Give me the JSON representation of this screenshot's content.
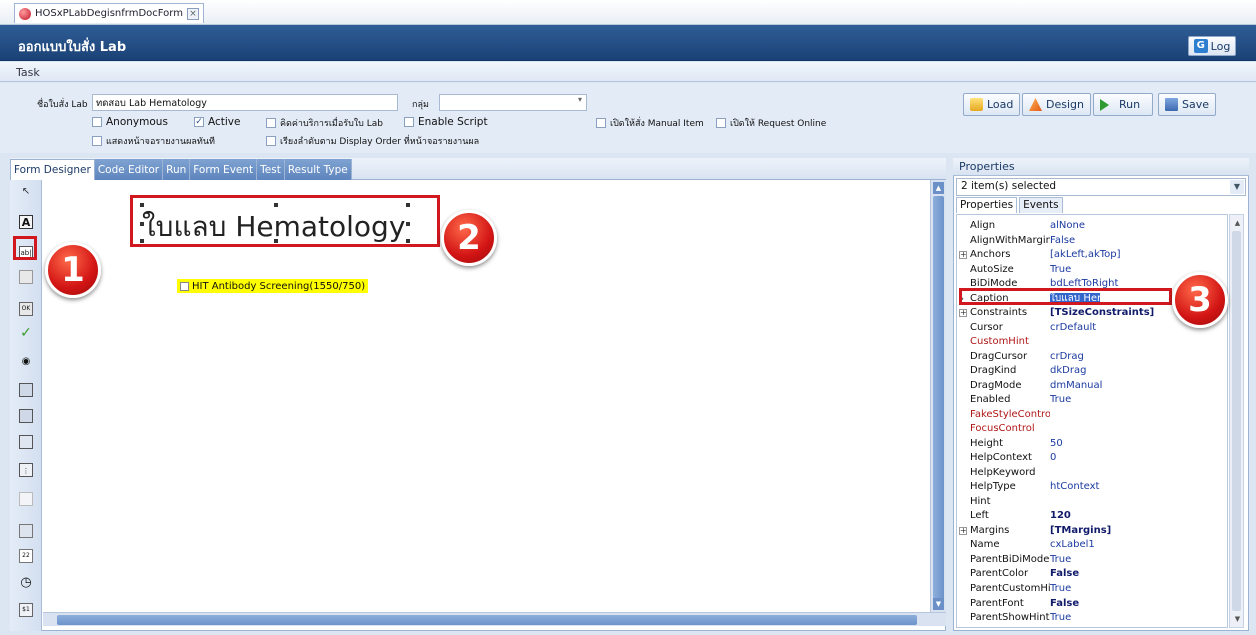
{
  "window_tab": {
    "label": "HOSxPLabDegisnfrmDocForm",
    "close": "×"
  },
  "header": {
    "title": "ออกแบบใบสั่ง Lab",
    "log_label": "Log",
    "log_icon": "G"
  },
  "task_label": "Task",
  "form": {
    "name_label": "ชื่อใบสั่ง Lab",
    "name_value": "ทดสอบ Lab Hematology",
    "group_label": "กลุ่ม",
    "group_value": "",
    "checkboxes": [
      {
        "label": "Anonymous",
        "checked": false
      },
      {
        "label": "Active",
        "checked": true
      },
      {
        "label": "คิดค่าบริการเมื่อรับใบ Lab",
        "checked": false
      },
      {
        "label": "Enable Script",
        "checked": false
      },
      {
        "label": "เปิดให้สั่ง Manual Item",
        "checked": false
      },
      {
        "label": "เปิดให้ Request Online",
        "checked": false
      },
      {
        "label": "แสดงหน้าจอรายงานผลทันที",
        "checked": false
      },
      {
        "label": "เรียงลำดับตาม Display Order ที่หน้าจอรายงานผล",
        "checked": false
      }
    ]
  },
  "toolbar": {
    "load": "Load",
    "design": "Design",
    "run": "Run",
    "save": "Save"
  },
  "designer_tabs": [
    "Form Designer",
    "Code Editor",
    "Run",
    "Form Event",
    "Test",
    "Result Type"
  ],
  "tools": [
    "pointer-icon",
    "label-tool-icon",
    "edit-tool-icon",
    "memo-tool-icon",
    "button-tool-icon",
    "checkmark-tool-icon",
    "radio-tool-icon",
    "listbox-tool-icon",
    "combobox-tool-icon",
    "panel-tool-icon",
    "radiogroup-tool-icon",
    "groupbox-tool-icon",
    "image-tool-icon",
    "date-tool-icon",
    "time-tool-icon",
    "currency-tool-icon"
  ],
  "canvas": {
    "label_caption": "ใบแลบ Hematology",
    "checkbox_caption": "HIT Antibody Screening(1550/750)"
  },
  "callouts": [
    "1",
    "2",
    "3"
  ],
  "properties": {
    "header": "Properties",
    "selection": "2 item(s) selected",
    "tabs": [
      "Properties",
      "Events"
    ],
    "rows": [
      {
        "name": "Align",
        "value": "alNone"
      },
      {
        "name": "AlignWithMargin",
        "value": "False"
      },
      {
        "name": "Anchors",
        "value": "[akLeft,akTop]",
        "expand": true
      },
      {
        "name": "AutoSize",
        "value": "True"
      },
      {
        "name": "BiDiMode",
        "value": "bdLeftToRight"
      },
      {
        "name": "Caption",
        "value": "ใบแลบ Hematology",
        "selected": true
      },
      {
        "name": "Constraints",
        "value": "[TSizeConstraints]",
        "expand": true,
        "bold": true
      },
      {
        "name": "Cursor",
        "value": "crDefault"
      },
      {
        "name": "CustomHint",
        "value": "",
        "red": true
      },
      {
        "name": "DragCursor",
        "value": "crDrag"
      },
      {
        "name": "DragKind",
        "value": "dkDrag"
      },
      {
        "name": "DragMode",
        "value": "dmManual"
      },
      {
        "name": "Enabled",
        "value": "True"
      },
      {
        "name": "FakeStyleControl",
        "value": "",
        "red": true
      },
      {
        "name": "FocusControl",
        "value": "",
        "red": true
      },
      {
        "name": "Height",
        "value": "50"
      },
      {
        "name": "HelpContext",
        "value": "0"
      },
      {
        "name": "HelpKeyword",
        "value": ""
      },
      {
        "name": "HelpType",
        "value": "htContext"
      },
      {
        "name": "Hint",
        "value": ""
      },
      {
        "name": "Left",
        "value": "120",
        "bold": true
      },
      {
        "name": "Margins",
        "value": "[TMargins]",
        "expand": true,
        "bold": true
      },
      {
        "name": "Name",
        "value": "cxLabel1"
      },
      {
        "name": "ParentBiDiMode",
        "value": "True"
      },
      {
        "name": "ParentColor",
        "value": "False",
        "bold": true
      },
      {
        "name": "ParentCustomHint",
        "value": "True"
      },
      {
        "name": "ParentFont",
        "value": "False",
        "bold": true
      },
      {
        "name": "ParentShowHint",
        "value": "True"
      }
    ]
  },
  "colors": {
    "accent": "#1b4276",
    "highlight": "#d0181e",
    "checkbox_bg": "#ffff00"
  }
}
